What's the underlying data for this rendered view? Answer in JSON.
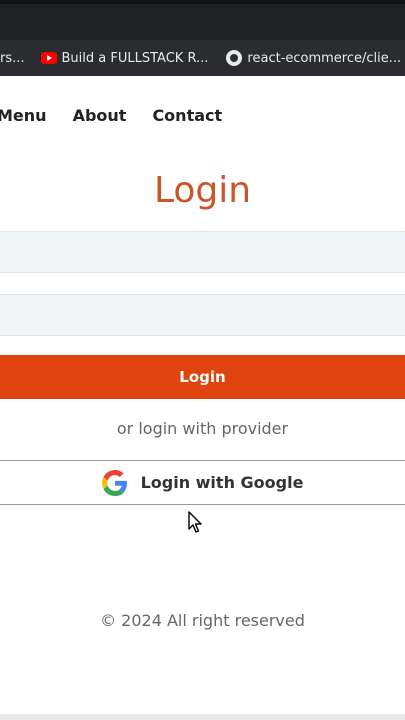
{
  "bookmarks": [
    {
      "label": "ers...",
      "icon": "none"
    },
    {
      "label": "Build a FULLSTACK R...",
      "icon": "youtube-icon"
    },
    {
      "label": "react-ecommerce/clie...",
      "icon": "github-icon"
    }
  ],
  "nav": {
    "menu": "Menu",
    "about": "About",
    "contact": "Contact"
  },
  "form": {
    "title": "Login",
    "email_value": "",
    "password_value": "",
    "login_button": "Login",
    "provider_text": "or login with provider",
    "google_button": "Login with Google"
  },
  "footer": {
    "text": "© 2024 All right reserved"
  },
  "colors": {
    "accent": "#e0440e",
    "title": "#c9552b"
  }
}
